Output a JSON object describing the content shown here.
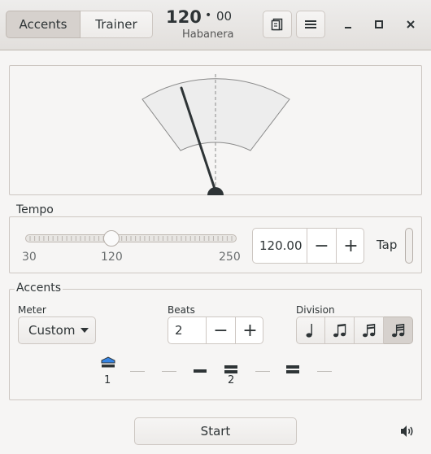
{
  "header": {
    "tabs": [
      {
        "label": "Accents",
        "selected": true
      },
      {
        "label": "Trainer",
        "selected": false
      }
    ],
    "bpm": "120",
    "separator": "•",
    "time": "00",
    "rhythm_name": "Habanera",
    "icons": [
      "book-icon",
      "menu-icon",
      "minimize-icon",
      "maximize-icon",
      "close-icon"
    ]
  },
  "tempo": {
    "legend": "Tempo",
    "slider_min_label": "30",
    "slider_mid_label": "120",
    "slider_max_label": "250",
    "slider_value_fraction": 0.409,
    "value": "120.00",
    "minus": "−",
    "plus": "+",
    "tap_label": "Tap"
  },
  "accents": {
    "legend": "Accents",
    "meter_label": "Meter",
    "meter_value": "Custom",
    "beats_label": "Beats",
    "beats_value": "2",
    "minus": "−",
    "plus": "+",
    "division_label": "Division",
    "divisions": [
      "quarter-note-icon",
      "eighth-note-icon",
      "sixteenth-note-icon",
      "thirty-second-note-icon"
    ],
    "selected_division": 3,
    "beat_numbers": [
      "1",
      "2"
    ]
  },
  "footer": {
    "start_label": "Start",
    "volume_icon": "volume-icon"
  },
  "colors": {
    "accent": "#3584e4",
    "background": "#f6f5f4",
    "border": "#cdc7c2"
  }
}
